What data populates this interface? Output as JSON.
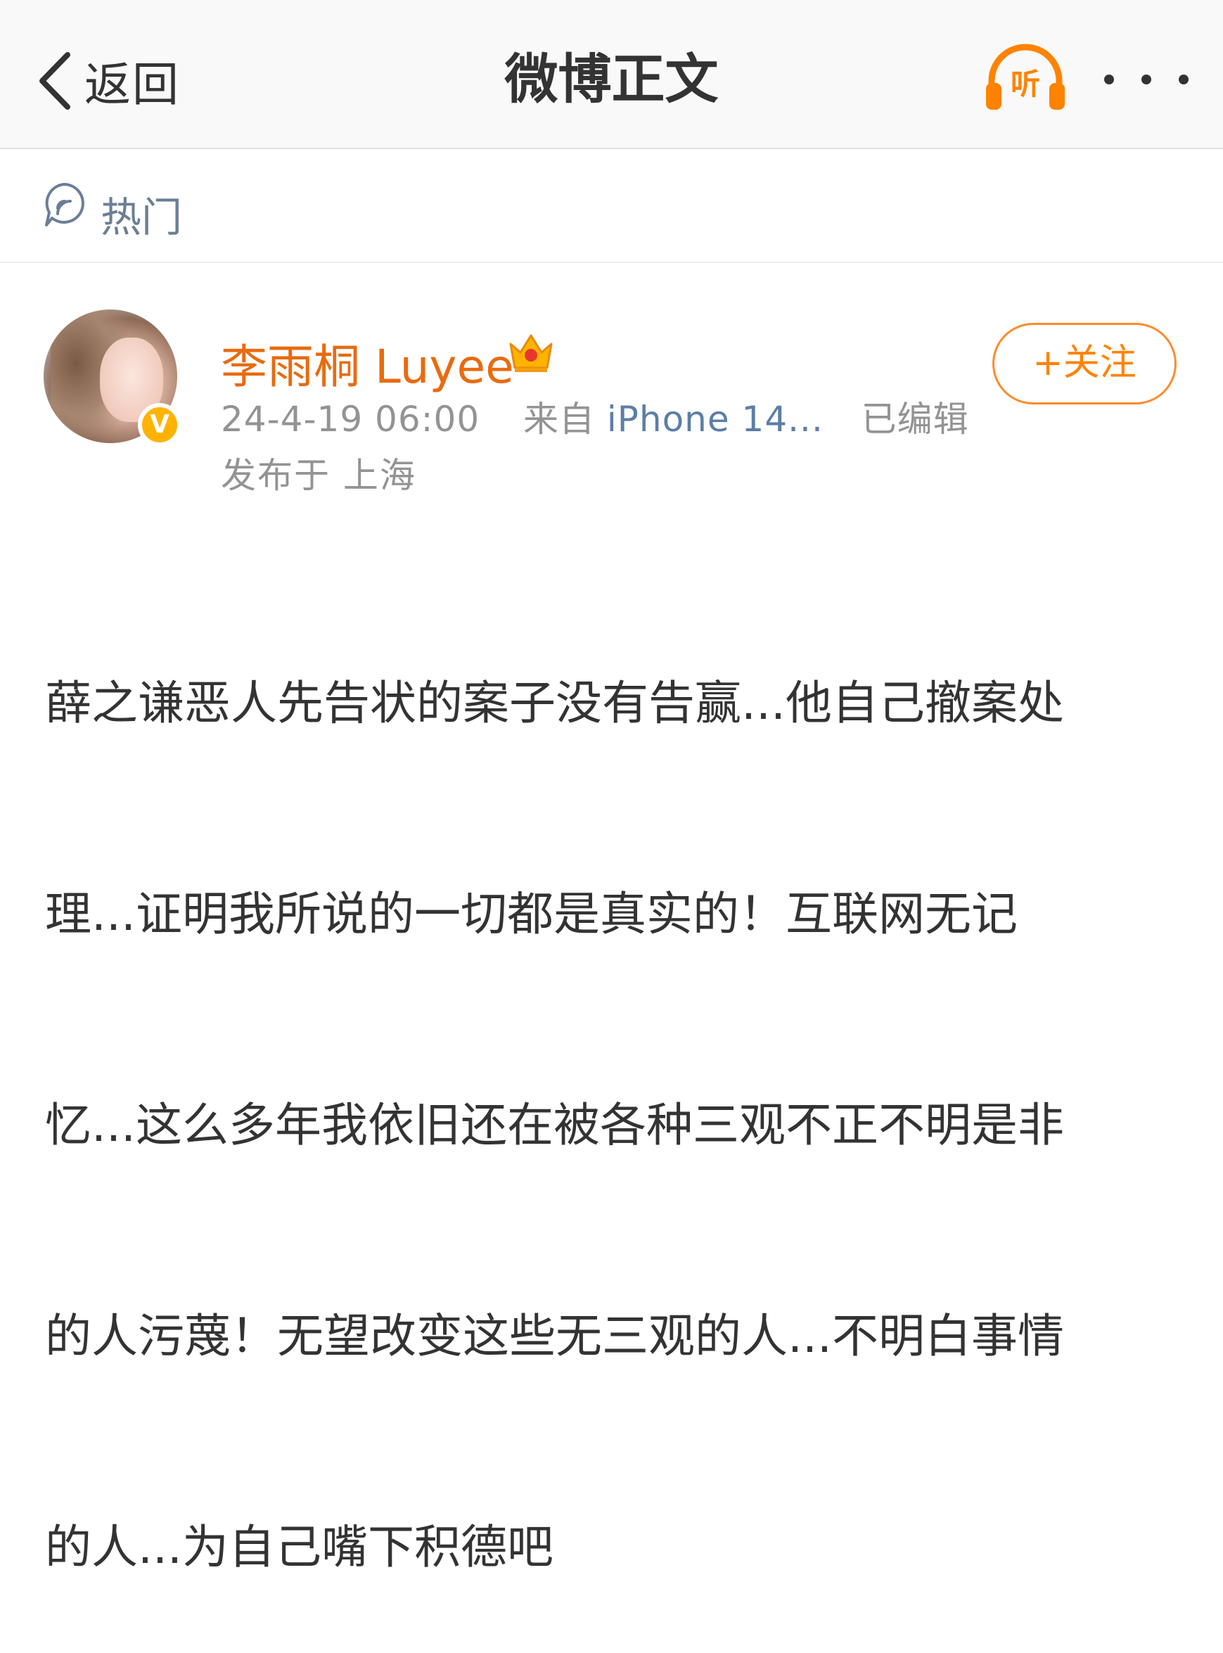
{
  "nav": {
    "back_label": "返回",
    "title": "微博正文",
    "listen_label": "听"
  },
  "hot": {
    "label": "热门"
  },
  "post": {
    "author": "李雨桐 Luyee",
    "timestamp": "24-4-19 06:00",
    "from_label": "来自",
    "source": "iPhone 14...",
    "edited": "已编辑",
    "location": "发布于 上海",
    "follow_label": "+关注",
    "verified_mark": "V",
    "text_lines": [
      "薛之谦恶人先告状的案子没有告赢...他自己撤案处",
      "理...证明我所说的一切都是真实的！互联网无记",
      "忆...这么多年我依旧还在被各种三观不正不明是非",
      "的人污蔑！无望改变这些无三观的人...不明白事情",
      "的人...为自己嘴下积德吧"
    ]
  },
  "colors": {
    "accent": "#ff8200",
    "username": "#e86b0f",
    "source_link": "#5c7ea6",
    "hot_label": "#6a7f96",
    "meta_text": "#939393"
  },
  "icons": [
    "back-chevron-icon",
    "headphones-icon",
    "more-dots-icon",
    "hot-topic-icon",
    "verified-badge-icon",
    "crown-icon"
  ]
}
